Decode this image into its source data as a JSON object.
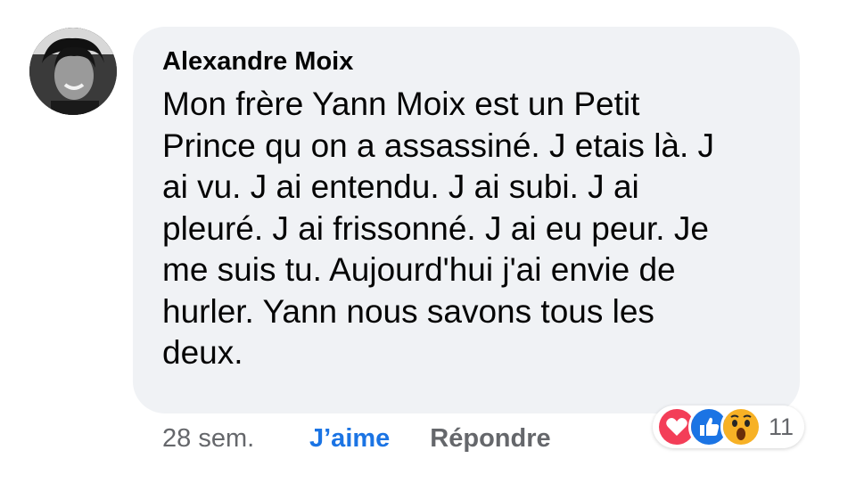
{
  "comment": {
    "author": "Alexandre Moix",
    "text_lines": [
      "Mon frère Yann Moix est un Petit",
      "Prince qu on a assassiné. J etais là. J",
      "ai vu. J ai entendu. J ai subi. J ai",
      "pleuré. J ai frissonné. J ai eu peur. Je",
      "me suis tu. Aujourd'hui j'ai envie de",
      "hurler. Yann nous savons tous les",
      "deux."
    ]
  },
  "actions": {
    "time": "28 sem.",
    "like_label": "J’aime",
    "reply_label": "Répondre"
  },
  "reactions": {
    "icons": [
      "love-icon",
      "like-icon",
      "wow-icon"
    ],
    "count": "11"
  },
  "colors": {
    "bubble": "#f0f2f5",
    "like": "#1b74e4",
    "love": "#f33e58",
    "wow": "#f7b125"
  }
}
